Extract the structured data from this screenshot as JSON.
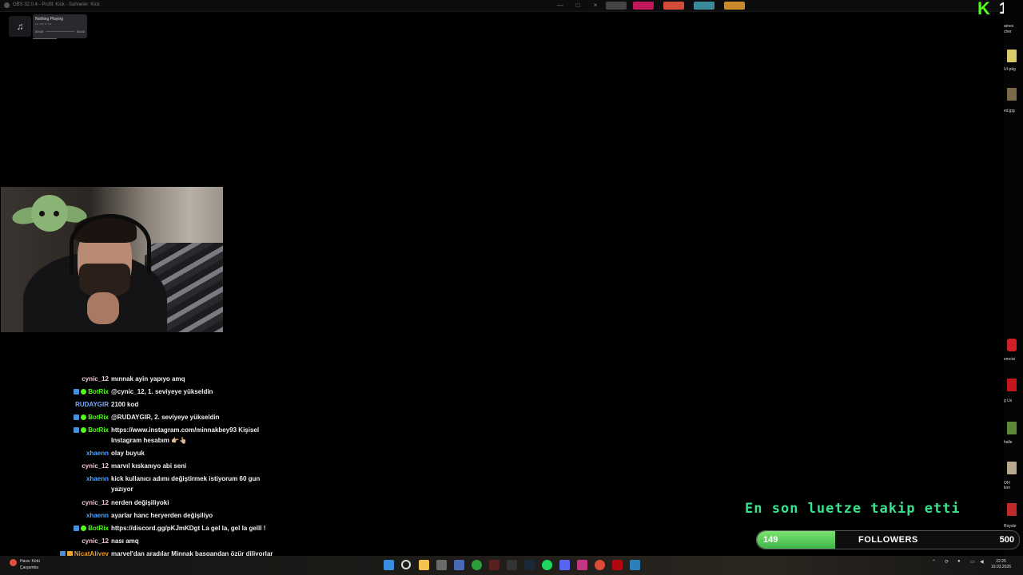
{
  "window": {
    "title": "OBS 32.0.4 - Profil: Kick - Sahneler: Kick",
    "controls": [
      "—",
      "□",
      "×"
    ]
  },
  "media": {
    "status": "Nothing Playing",
    "sub": "••• •••• •• •••",
    "time_start": "00:00",
    "time_end": "00:00",
    "icon": "music-note-icon"
  },
  "kick": {
    "logo": "K",
    "viewer_count": "13",
    "brand_color": "#53fc18"
  },
  "desktop_icons": [
    {
      "label": "ames\ncher"
    },
    {
      "label": "UI-pkg"
    },
    {
      "label": "ed.jpg"
    },
    {
      "label": "emcisi"
    },
    {
      "label": "g Us"
    },
    {
      "label": "halle"
    },
    {
      "label": "Oh!\nkon"
    },
    {
      "label": "Royale"
    }
  ],
  "chat": {
    "messages": [
      {
        "user": "cynic_12",
        "color": "#f3c3d9",
        "badges": [],
        "text": "mınnak ayin yapıyo amq"
      },
      {
        "user": "BotRix",
        "color": "#53fc18",
        "badges": [
          "bot",
          "verified"
        ],
        "text": "@cynic_12, 1. seviyeye yükseldin"
      },
      {
        "user": "RUDAYGIR",
        "color": "#79a8f7",
        "badges": [],
        "text": "2100 kod"
      },
      {
        "user": "BotRix",
        "color": "#53fc18",
        "badges": [
          "bot",
          "verified"
        ],
        "text": "@RUDAYGIR, 2. seviyeye yükseldin"
      },
      {
        "user": "BotRix",
        "color": "#53fc18",
        "badges": [
          "bot",
          "verified"
        ],
        "text": "https://www.instagram.com/minnakbey93 Kişisel Instagram hesabım 👉🏼👆🏼"
      },
      {
        "user": "xhaenn",
        "color": "#4ea1ff",
        "badges": [],
        "text": "olay buyuk"
      },
      {
        "user": "cynic_12",
        "color": "#f3c3d9",
        "badges": [],
        "text": "marvıl kıskanıyo abi seni"
      },
      {
        "user": "xhaenn",
        "color": "#4ea1ff",
        "badges": [],
        "text": "kick kullanıcı adımı değiştirmek istiyorum 60 gun yazıyor"
      },
      {
        "user": "cynic_12",
        "color": "#f3c3d9",
        "badges": [],
        "text": "nerden değişiliyoki"
      },
      {
        "user": "xhaenn",
        "color": "#4ea1ff",
        "badges": [],
        "text": "ayarlar hanc heryerden değişiliyo"
      },
      {
        "user": "BotRix",
        "color": "#53fc18",
        "badges": [
          "bot",
          "verified"
        ],
        "text": "https://discord.gg/pKJmKDgt La gel la, gel la gelll !"
      },
      {
        "user": "cynic_12",
        "color": "#f3c3d9",
        "badges": [],
        "text": "nası amq"
      },
      {
        "user": "NicatAliyev",
        "color": "#f0a12b",
        "badges": [
          "bot",
          "gift"
        ],
        "text": "marvel'dan aradılar Minnak başgandan özür diliyorlar şuan"
      }
    ]
  },
  "ticker": {
    "text": "En son luetze takip etti",
    "color": "#39e38c"
  },
  "follower_goal": {
    "current": "149",
    "label": "FOLLOWERS",
    "target": "500",
    "progress": 0.298,
    "color": "#53c23f"
  },
  "taskbar": {
    "weather_line1": "Hava: Kötü",
    "weather_line2": "Çarşamba",
    "time": "22:25",
    "date": "19.03.2026",
    "apps": [
      "windows-start-icon",
      "search-icon",
      "file-explorer-icon",
      "calculator-icon",
      "snipping-icon",
      "xbox-icon",
      "app-icon",
      "display-icon",
      "steam-icon",
      "spotify-icon",
      "discord-icon",
      "instagram-icon",
      "chrome-icon",
      "netflix-icon",
      "monitor-icon"
    ],
    "tray_icons": [
      "chevron-up-icon",
      "sync-icon",
      "mic-icon",
      "network-icon",
      "volume-icon"
    ]
  }
}
